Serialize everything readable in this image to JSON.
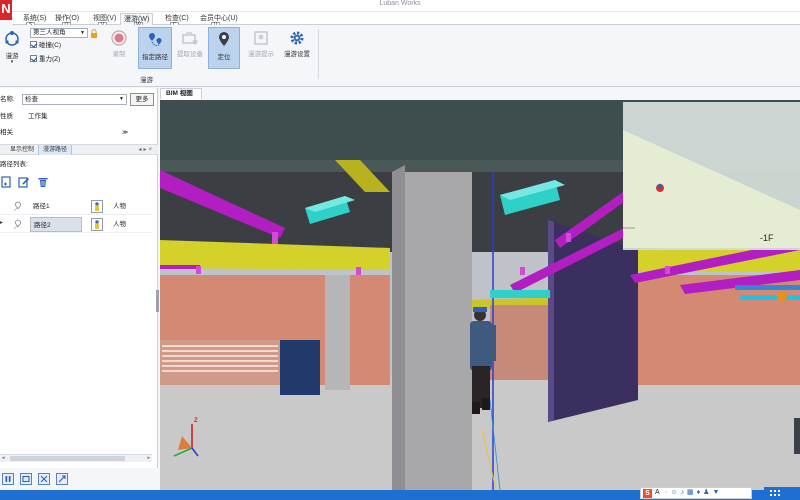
{
  "window": {
    "title": "Luban Works",
    "logo": "N"
  },
  "menu": {
    "items": [
      "系统(S)",
      "操作(O)",
      "视图(V)",
      "漫游(W)",
      "检查(C)",
      "会员中心(U)"
    ],
    "keytips": [
      "S",
      "O",
      "V",
      "W",
      "C",
      "U"
    ]
  },
  "ribbon": {
    "roam_label": "漫游",
    "view_mode": "第三人视角",
    "collision_label": "碰撞(C)",
    "gravity_label": "重力(Z)",
    "record_label": "录制",
    "assign_route_label": "指定路径",
    "extract_device_label": "提取设备",
    "locate_label": "定位",
    "roam_tips_label": "漫游提示",
    "roam_settings_label": "漫游设置",
    "group_label": "漫游"
  },
  "left_panel": {
    "plan_name_label": "名称:",
    "plan_name_value": "检查",
    "more_button": "更多",
    "plan_nature_label": "性质",
    "plan_nature_value": "工作集",
    "related_label": "相关",
    "tabs": [
      "显示控制",
      "漫游路径"
    ],
    "route_list_label": "路径列表:",
    "routes": [
      {
        "name": "路径1",
        "type": "人物"
      },
      {
        "name": "路径2",
        "type": "人物"
      }
    ]
  },
  "viewport": {
    "tab_label": "BIM 视图",
    "floor_label": "-1F",
    "axis_z": "Z"
  },
  "ime": {
    "logo": "S",
    "text": "A"
  },
  "colors": {
    "ribbon_selected": "#bcd3ee",
    "pipe_magenta": "#b21ec2",
    "wall_salmon": "#d48a72",
    "beam_yellow": "#d4d12a",
    "ceiling_teal": "#3e4e4e",
    "duct_cyan": "#2ed0c8",
    "taskbar_blue": "#1e6fd1"
  }
}
